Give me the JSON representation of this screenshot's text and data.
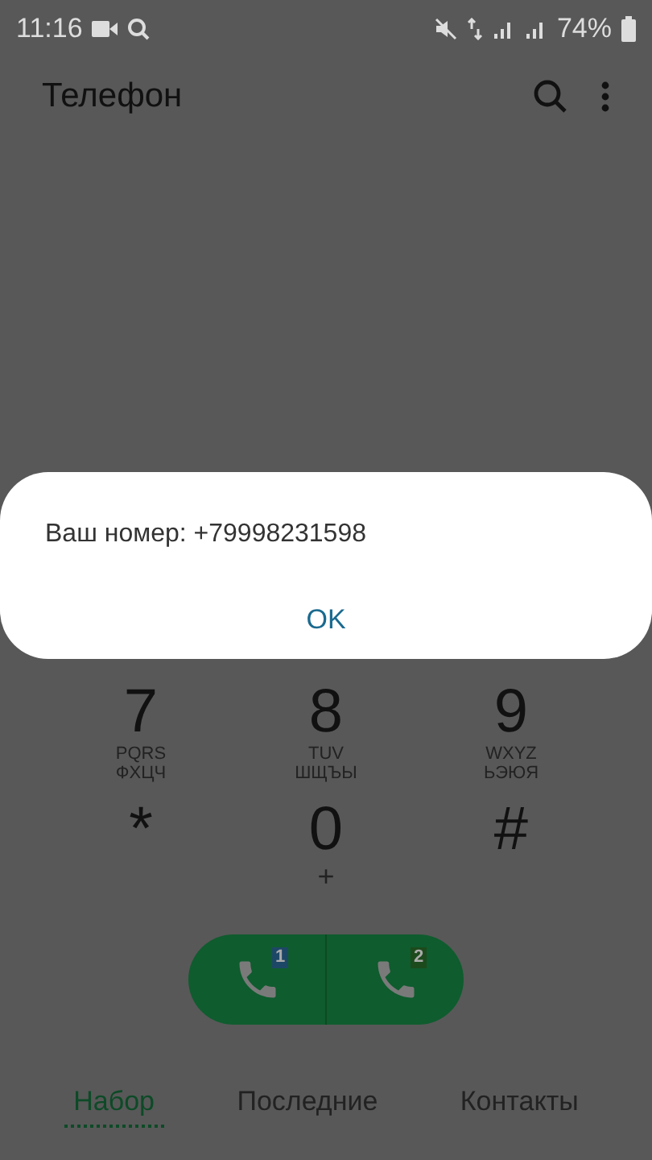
{
  "status_bar": {
    "time": "11:16",
    "battery": "74%"
  },
  "app_bar": {
    "title": "Телефон"
  },
  "keypad": {
    "rows": [
      [
        {
          "digit": "7",
          "letters": "PQRS",
          "letters_alt": "ФХЦЧ"
        },
        {
          "digit": "8",
          "letters": "TUV",
          "letters_alt": "ШЩЪЫ"
        },
        {
          "digit": "9",
          "letters": "WXYZ",
          "letters_alt": "ЬЭЮЯ"
        }
      ],
      [
        {
          "digit": "*"
        },
        {
          "digit": "0",
          "sub": "+"
        },
        {
          "digit": "#"
        }
      ]
    ]
  },
  "call_buttons": [
    {
      "sim": "1",
      "color": "#1d4766"
    },
    {
      "sim": "2",
      "color": "#1c4a1c"
    }
  ],
  "tabs": [
    {
      "label": "Набор",
      "selected": true
    },
    {
      "label": "Последние",
      "selected": false
    },
    {
      "label": "Контакты",
      "selected": false
    }
  ],
  "dialog": {
    "message": "Ваш номер: +79998231598",
    "button": "OK"
  }
}
